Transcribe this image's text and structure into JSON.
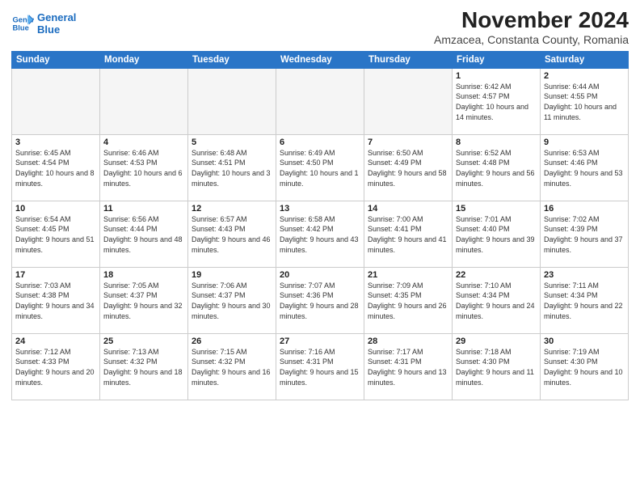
{
  "logo": {
    "line1": "General",
    "line2": "Blue"
  },
  "title": "November 2024",
  "location": "Amzacea, Constanta County, Romania",
  "days_header": [
    "Sunday",
    "Monday",
    "Tuesday",
    "Wednesday",
    "Thursday",
    "Friday",
    "Saturday"
  ],
  "weeks": [
    [
      {
        "day": "",
        "info": ""
      },
      {
        "day": "",
        "info": ""
      },
      {
        "day": "",
        "info": ""
      },
      {
        "day": "",
        "info": ""
      },
      {
        "day": "",
        "info": ""
      },
      {
        "day": "1",
        "info": "Sunrise: 6:42 AM\nSunset: 4:57 PM\nDaylight: 10 hours and 14 minutes."
      },
      {
        "day": "2",
        "info": "Sunrise: 6:44 AM\nSunset: 4:55 PM\nDaylight: 10 hours and 11 minutes."
      }
    ],
    [
      {
        "day": "3",
        "info": "Sunrise: 6:45 AM\nSunset: 4:54 PM\nDaylight: 10 hours and 8 minutes."
      },
      {
        "day": "4",
        "info": "Sunrise: 6:46 AM\nSunset: 4:53 PM\nDaylight: 10 hours and 6 minutes."
      },
      {
        "day": "5",
        "info": "Sunrise: 6:48 AM\nSunset: 4:51 PM\nDaylight: 10 hours and 3 minutes."
      },
      {
        "day": "6",
        "info": "Sunrise: 6:49 AM\nSunset: 4:50 PM\nDaylight: 10 hours and 1 minute."
      },
      {
        "day": "7",
        "info": "Sunrise: 6:50 AM\nSunset: 4:49 PM\nDaylight: 9 hours and 58 minutes."
      },
      {
        "day": "8",
        "info": "Sunrise: 6:52 AM\nSunset: 4:48 PM\nDaylight: 9 hours and 56 minutes."
      },
      {
        "day": "9",
        "info": "Sunrise: 6:53 AM\nSunset: 4:46 PM\nDaylight: 9 hours and 53 minutes."
      }
    ],
    [
      {
        "day": "10",
        "info": "Sunrise: 6:54 AM\nSunset: 4:45 PM\nDaylight: 9 hours and 51 minutes."
      },
      {
        "day": "11",
        "info": "Sunrise: 6:56 AM\nSunset: 4:44 PM\nDaylight: 9 hours and 48 minutes."
      },
      {
        "day": "12",
        "info": "Sunrise: 6:57 AM\nSunset: 4:43 PM\nDaylight: 9 hours and 46 minutes."
      },
      {
        "day": "13",
        "info": "Sunrise: 6:58 AM\nSunset: 4:42 PM\nDaylight: 9 hours and 43 minutes."
      },
      {
        "day": "14",
        "info": "Sunrise: 7:00 AM\nSunset: 4:41 PM\nDaylight: 9 hours and 41 minutes."
      },
      {
        "day": "15",
        "info": "Sunrise: 7:01 AM\nSunset: 4:40 PM\nDaylight: 9 hours and 39 minutes."
      },
      {
        "day": "16",
        "info": "Sunrise: 7:02 AM\nSunset: 4:39 PM\nDaylight: 9 hours and 37 minutes."
      }
    ],
    [
      {
        "day": "17",
        "info": "Sunrise: 7:03 AM\nSunset: 4:38 PM\nDaylight: 9 hours and 34 minutes."
      },
      {
        "day": "18",
        "info": "Sunrise: 7:05 AM\nSunset: 4:37 PM\nDaylight: 9 hours and 32 minutes."
      },
      {
        "day": "19",
        "info": "Sunrise: 7:06 AM\nSunset: 4:37 PM\nDaylight: 9 hours and 30 minutes."
      },
      {
        "day": "20",
        "info": "Sunrise: 7:07 AM\nSunset: 4:36 PM\nDaylight: 9 hours and 28 minutes."
      },
      {
        "day": "21",
        "info": "Sunrise: 7:09 AM\nSunset: 4:35 PM\nDaylight: 9 hours and 26 minutes."
      },
      {
        "day": "22",
        "info": "Sunrise: 7:10 AM\nSunset: 4:34 PM\nDaylight: 9 hours and 24 minutes."
      },
      {
        "day": "23",
        "info": "Sunrise: 7:11 AM\nSunset: 4:34 PM\nDaylight: 9 hours and 22 minutes."
      }
    ],
    [
      {
        "day": "24",
        "info": "Sunrise: 7:12 AM\nSunset: 4:33 PM\nDaylight: 9 hours and 20 minutes."
      },
      {
        "day": "25",
        "info": "Sunrise: 7:13 AM\nSunset: 4:32 PM\nDaylight: 9 hours and 18 minutes."
      },
      {
        "day": "26",
        "info": "Sunrise: 7:15 AM\nSunset: 4:32 PM\nDaylight: 9 hours and 16 minutes."
      },
      {
        "day": "27",
        "info": "Sunrise: 7:16 AM\nSunset: 4:31 PM\nDaylight: 9 hours and 15 minutes."
      },
      {
        "day": "28",
        "info": "Sunrise: 7:17 AM\nSunset: 4:31 PM\nDaylight: 9 hours and 13 minutes."
      },
      {
        "day": "29",
        "info": "Sunrise: 7:18 AM\nSunset: 4:30 PM\nDaylight: 9 hours and 11 minutes."
      },
      {
        "day": "30",
        "info": "Sunrise: 7:19 AM\nSunset: 4:30 PM\nDaylight: 9 hours and 10 minutes."
      }
    ]
  ]
}
